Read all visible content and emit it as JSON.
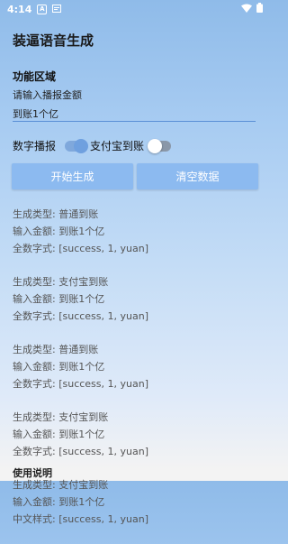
{
  "status": {
    "time": "4:14",
    "badge": "A"
  },
  "app": {
    "title": "装逼语音生成"
  },
  "section": {
    "title": "功能区域"
  },
  "input": {
    "placeholder": "请输入播报金额",
    "value": "到账1个亿"
  },
  "switches": {
    "number_label": "数字播报",
    "alipay_label": "支付宝到账",
    "number_on": true,
    "alipay_on": false
  },
  "buttons": {
    "generate": "开始生成",
    "clear": "清空数据"
  },
  "log": [
    {
      "l1": "生成类型: 普通到账",
      "l2": "输入金额: 到账1个亿",
      "l3": "全数字式: [success, 1, yuan]"
    },
    {
      "l1": "生成类型: 支付宝到账",
      "l2": "输入金额: 到账1个亿",
      "l3": "全数字式: [success, 1, yuan]"
    },
    {
      "l1": "生成类型: 普通到账",
      "l2": "输入金额: 到账1个亿",
      "l3": "全数字式: [success, 1, yuan]"
    },
    {
      "l1": "生成类型: 支付宝到账",
      "l2": "输入金额: 到账1个亿",
      "l3": "全数字式: [success, 1, yuan]"
    },
    {
      "l1": "生成类型: 支付宝到账",
      "l2": "输入金额: 到账1个亿",
      "l3": "中文样式: [success, 1, yuan]"
    }
  ],
  "usage": {
    "title": "使用说明"
  },
  "icons": {
    "wifi": "wifi-icon",
    "battery": "battery-icon",
    "notification": "notification-icon"
  }
}
